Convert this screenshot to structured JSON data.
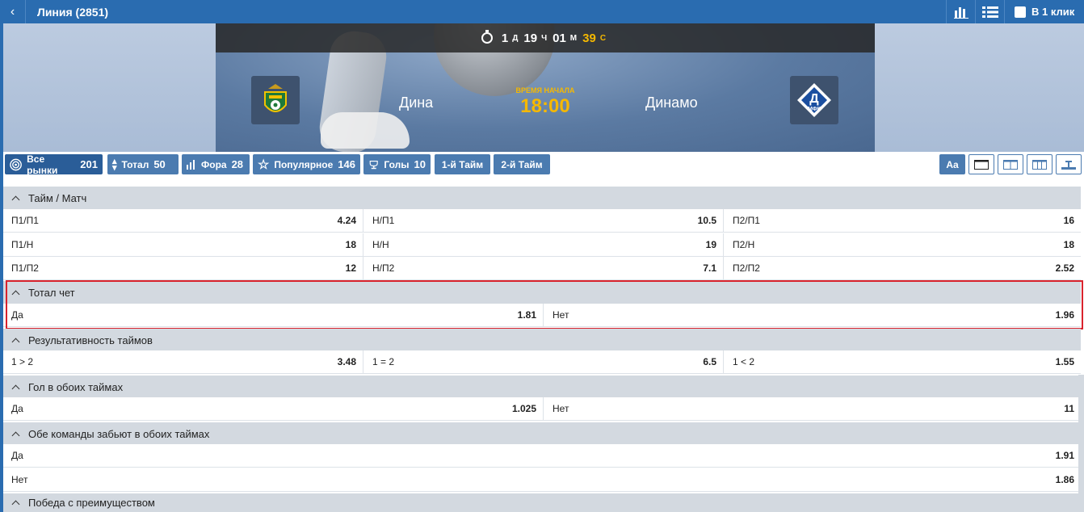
{
  "topbar": {
    "back_icon": "chevron-left-icon",
    "title": "Линия (2851)",
    "stats_icon": "bar-chart-icon",
    "list_icon": "list-view-icon",
    "one_click_label": "В 1 клик"
  },
  "event": {
    "timer": {
      "days": "1",
      "days_unit": "Д",
      "hours": "19",
      "hours_unit": "Ч",
      "minutes": "01",
      "minutes_unit": "М",
      "seconds": "39",
      "seconds_unit": "С"
    },
    "home_team": "Дина",
    "away_team": "Динамо",
    "start_label": "ВРЕМЯ НАЧАЛА",
    "start_time": "18:00",
    "home_logo_icon": "dina-club-logo",
    "away_logo_icon": "dynamo-mfk-logo",
    "away_logo_text": "МФК"
  },
  "filters": [
    {
      "label": "Все рынки",
      "count": "201",
      "icon": "target-icon"
    },
    {
      "label": "Тотал",
      "count": "50",
      "icon": "updown-icon"
    },
    {
      "label": "Фора",
      "count": "28",
      "icon": "bars-icon"
    },
    {
      "label": "Популярное",
      "count": "146",
      "icon": "star-icon"
    },
    {
      "label": "Голы",
      "count": "10",
      "icon": "trophy-icon"
    },
    {
      "label": "1-й Тайм",
      "count": ""
    },
    {
      "label": "2-й Тайм",
      "count": ""
    }
  ],
  "view_buttons": {
    "font_label": "Aa"
  },
  "markets": [
    {
      "title": "Тайм / Матч",
      "rows": [
        [
          {
            "label": "П1/П1",
            "odd": "4.24"
          },
          {
            "label": "Н/П1",
            "odd": "10.5"
          },
          {
            "label": "П2/П1",
            "odd": "16"
          }
        ],
        [
          {
            "label": "П1/Н",
            "odd": "18"
          },
          {
            "label": "Н/Н",
            "odd": "19"
          },
          {
            "label": "П2/Н",
            "odd": "18"
          }
        ],
        [
          {
            "label": "П1/П2",
            "odd": "12"
          },
          {
            "label": "Н/П2",
            "odd": "7.1"
          },
          {
            "label": "П2/П2",
            "odd": "2.52"
          }
        ]
      ]
    },
    {
      "title": "Тотал чет",
      "rows": [
        [
          {
            "label": "Да",
            "odd": "1.81"
          },
          {
            "label": "Нет",
            "odd": "1.96"
          }
        ]
      ]
    },
    {
      "title": "Результативность таймов",
      "rows": [
        [
          {
            "label": "1 > 2",
            "odd": "3.48"
          },
          {
            "label": "1 = 2",
            "odd": "6.5"
          },
          {
            "label": "1 < 2",
            "odd": "1.55"
          }
        ]
      ]
    },
    {
      "title": "Гол в обоих таймах",
      "rows": [
        [
          {
            "label": "Да",
            "odd": "1.025"
          },
          {
            "label": "Нет",
            "odd": "11"
          }
        ]
      ]
    },
    {
      "title": "Обе команды забьют в обоих таймах",
      "rows": [
        [
          {
            "label": "Да",
            "odd": "1.91"
          }
        ],
        [
          {
            "label": "Нет",
            "odd": "1.86"
          }
        ]
      ]
    },
    {
      "title": "Победа с преимуществом",
      "rows": []
    }
  ],
  "colors": {
    "primary": "#2a6cb0",
    "accent": "#f5b800",
    "highlight": "#d9232d",
    "section": "#d3d9e0"
  }
}
